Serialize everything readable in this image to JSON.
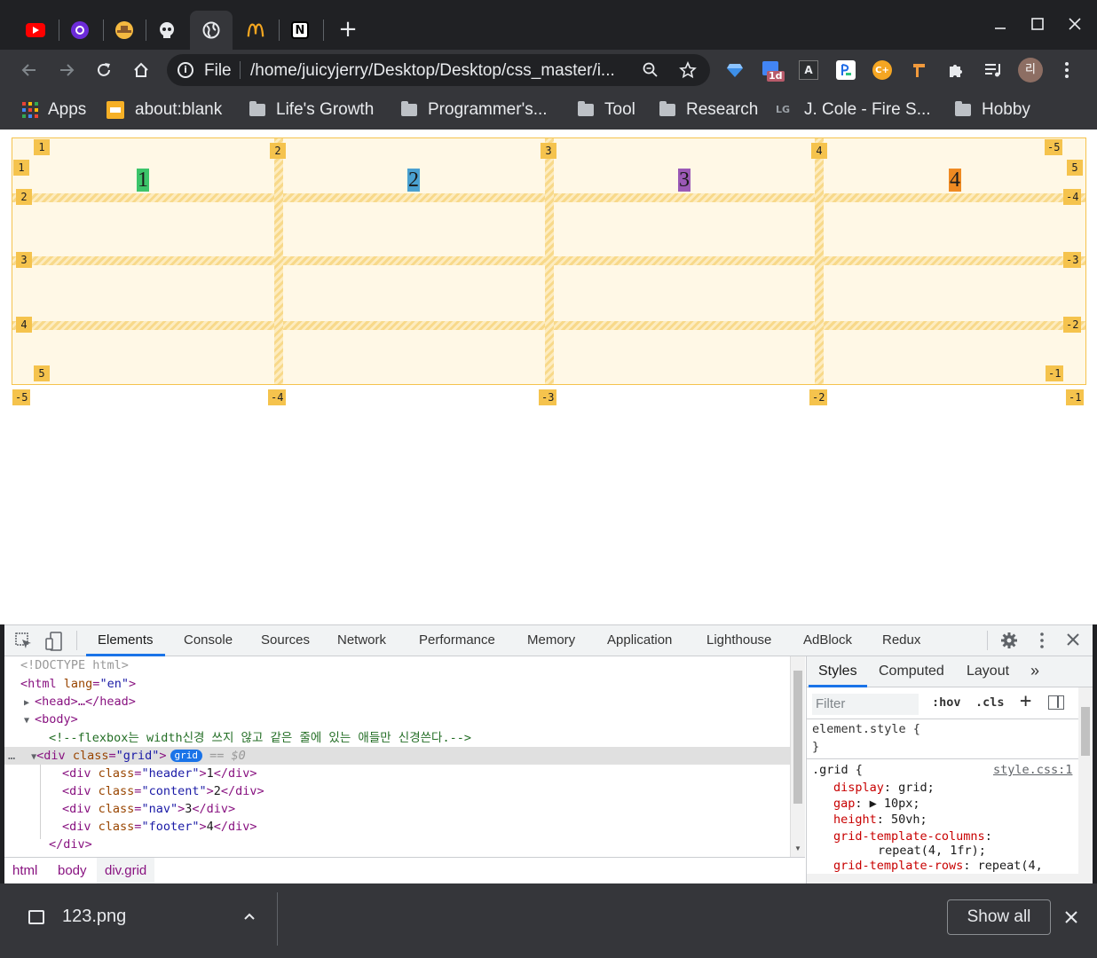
{
  "browser": {
    "tabs": [
      {
        "icon": "youtube-icon",
        "color": "#ff0000"
      },
      {
        "icon": "circle-app-icon",
        "color": "#6c2bd9"
      },
      {
        "icon": "cowboy-emoji-icon",
        "color": "#f5b940"
      },
      {
        "icon": "skull-icon",
        "color": "#e8eaed"
      },
      {
        "icon": "globe-icon",
        "color": "#e8eaed"
      },
      {
        "icon": "mcdonalds-icon",
        "color": "#f4a620"
      },
      {
        "icon": "notion-icon",
        "color": "#ffffff"
      }
    ],
    "new_tab": "+",
    "omnibox": {
      "scheme_label": "File",
      "url": "/home/juicyjerry/Desktop/Desktop/css_master/i..."
    },
    "extensions": [
      {
        "icon": "diamond-icon"
      },
      {
        "icon": "calendar-icon",
        "badge": "1d"
      },
      {
        "icon": "font-a-icon",
        "label": "A"
      },
      {
        "icon": "papago-icon"
      },
      {
        "icon": "coupon-c-icon",
        "label": "C+"
      },
      {
        "icon": "hammer-icon"
      },
      {
        "icon": "puzzle-icon"
      },
      {
        "icon": "playlist-icon"
      }
    ],
    "profile_label": "리",
    "bookmarks": [
      {
        "label": "Apps",
        "icon": "apps-grid-icon"
      },
      {
        "label": "about:blank",
        "icon": "page-icon"
      },
      {
        "label": "Life's Growth",
        "icon": "folder-icon"
      },
      {
        "label": "Programmer's...",
        "icon": "folder-icon"
      },
      {
        "label": "Tool",
        "icon": "folder-icon"
      },
      {
        "label": "Research",
        "icon": "folder-icon"
      },
      {
        "label": "J. Cole - Fire S...",
        "icon": "lg-icon"
      },
      {
        "label": "Hobby",
        "icon": "folder-icon"
      }
    ]
  },
  "page": {
    "items": [
      {
        "label": "1",
        "color": "#3cc46a"
      },
      {
        "label": "2",
        "color": "#4aa0d0"
      },
      {
        "label": "3",
        "color": "#9b59b6"
      },
      {
        "label": "4",
        "color": "#ef8a22"
      }
    ],
    "grid_overlay": {
      "top_col_labels": [
        "1",
        "2",
        "3",
        "4",
        "-5"
      ],
      "bottom_col_labels": [
        "-5",
        "-4",
        "-3",
        "-2",
        "-1"
      ],
      "left_row_labels": [
        "1",
        "2",
        "3",
        "4"
      ],
      "right_row_labels": [
        "5",
        "-4",
        "-3",
        "-2"
      ],
      "corner_bottom_left": "5",
      "corner_bottom_right": "-1"
    }
  },
  "devtools": {
    "tabs": [
      "Elements",
      "Console",
      "Sources",
      "Network",
      "Performance",
      "Memory",
      "Application",
      "Lighthouse",
      "AdBlock",
      "Redux"
    ],
    "active_tab": "Elements",
    "dom": {
      "doctype": "<!DOCTYPE html>",
      "html_open": "<html",
      "html_lang_attr": "lang",
      "html_lang_val": "\"en\"",
      "head": "<head>…</head>",
      "body_open": "<body>",
      "comment": "<!--flexbox는 width신경 쓰지 않고 같은 줄에 있는 애들만 신경쓴다.-->",
      "grid_div": "<div",
      "class_attr": "class",
      "grid_class_val": "\"grid\"",
      "grid_badge": "grid",
      "selected_marker": "== $0",
      "children": [
        {
          "class": "\"header\"",
          "text": "1"
        },
        {
          "class": "\"content\"",
          "text": "2"
        },
        {
          "class": "\"nav\"",
          "text": "3"
        },
        {
          "class": "\"footer\"",
          "text": "4"
        }
      ],
      "div_close": "</div>"
    },
    "breadcrumbs": [
      "html",
      "body",
      "div.grid"
    ],
    "styles": {
      "tabs": [
        "Styles",
        "Computed",
        "Layout"
      ],
      "filter_placeholder": "Filter",
      "hov": ":hov",
      "cls": ".cls",
      "element_style": "element.style {",
      "close_brace": "}",
      "rule_selector": ".grid {",
      "rule_source": "style.css:1",
      "declarations": [
        {
          "prop": "display",
          "value": "grid;"
        },
        {
          "prop": "gap",
          "value": "▶ 10px;"
        },
        {
          "prop": "height",
          "value": "50vh;"
        },
        {
          "prop": "grid-template-columns",
          "value": ""
        },
        {
          "prop": "",
          "value": "repeat(4, 1fr);"
        },
        {
          "prop": "grid-template-rows",
          "value": "repeat(4,"
        }
      ]
    }
  },
  "downloads": {
    "filename": "123.png",
    "show_all": "Show all"
  }
}
